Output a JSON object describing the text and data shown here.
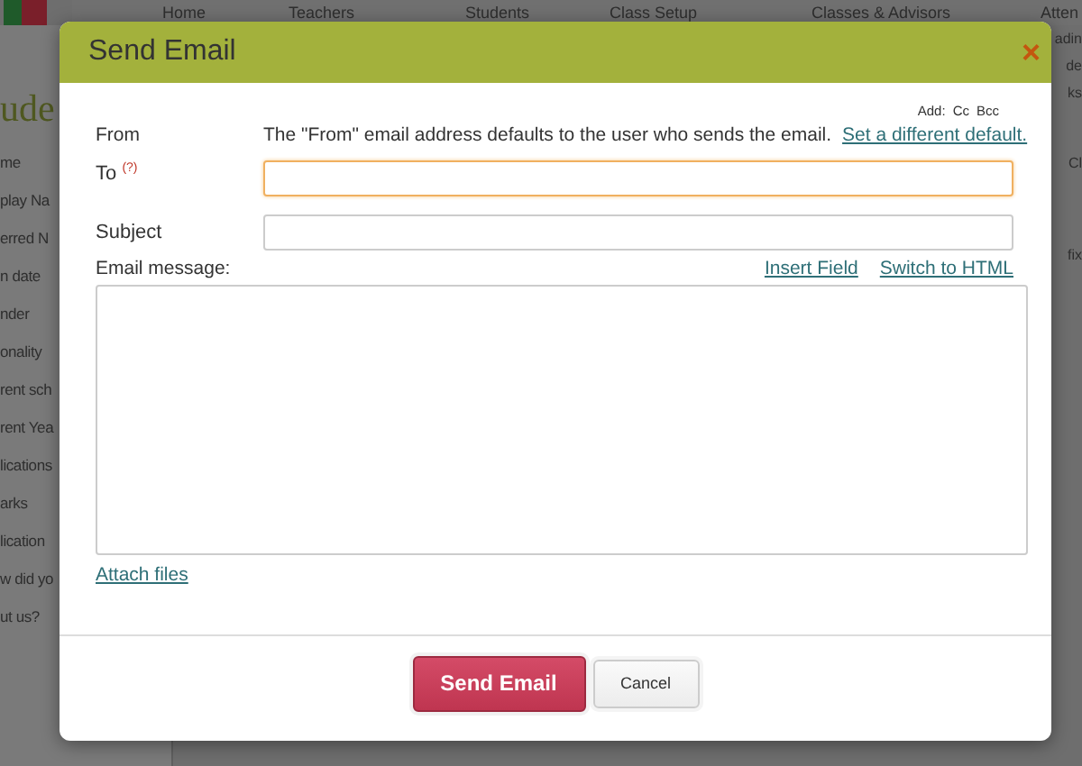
{
  "backdrop": {
    "nav": [
      "Home",
      "Teachers",
      "Students",
      "Class Setup",
      "Classes & Advisors",
      "Atten"
    ],
    "left_title": "ude",
    "left_items": [
      "me",
      "play Na",
      "erred N",
      "n date",
      "nder",
      "onality",
      "rent sch",
      "rent Yea",
      "lications",
      "arks",
      "lication",
      "w did yo",
      "ut us?"
    ],
    "right_items": [
      "adin",
      "de",
      "ks",
      "Cl",
      "fix"
    ]
  },
  "dialog": {
    "title": "Send Email",
    "close": "×",
    "add_label": "Add:",
    "add_links": [
      "Cc",
      "Bcc"
    ],
    "from_label": "From",
    "from_note": "The \"From\" email address defaults to the user who sends the email.",
    "from_link": "Set a different default.",
    "to_label": "To",
    "to_hint": "(?)",
    "to_focused": true,
    "subject_label": "Subject",
    "message_label": "Email message:",
    "message_links": [
      "Insert Field",
      "Switch to HTML"
    ],
    "attach_link": "Attach files",
    "buttons": [
      {
        "label": "Send Email",
        "kind": "primary"
      },
      {
        "label": "Cancel",
        "kind": "secondary"
      }
    ]
  }
}
